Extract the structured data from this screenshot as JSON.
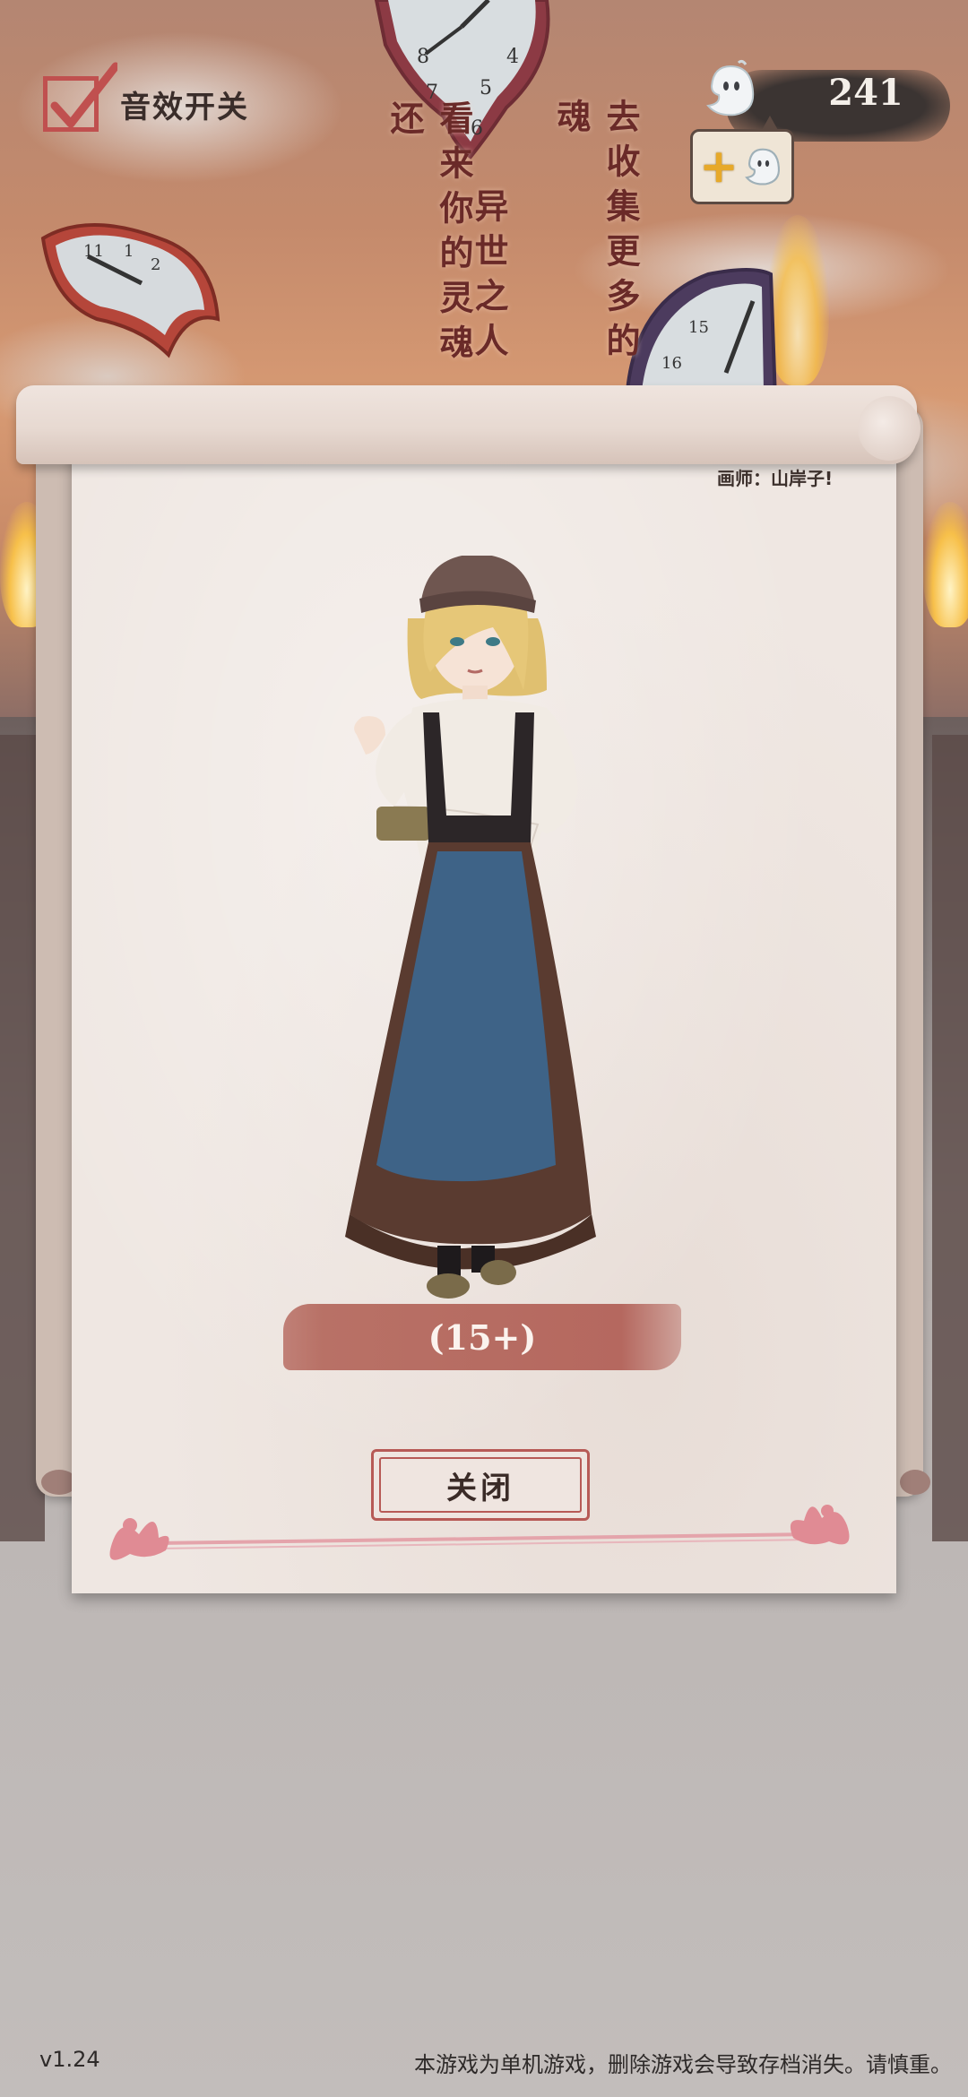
{
  "header": {
    "sound_toggle_label": "音效开关",
    "sound_enabled": true,
    "soul_currency": "241"
  },
  "story": {
    "line_right": "去收集更多的魂",
    "line_middle": "异世之人",
    "line_left": "看来你的灵魂还"
  },
  "card": {
    "artist_credit": "画师：山岸子!",
    "age_label": "(15+)",
    "close_label": "关闭"
  },
  "footer": {
    "version": "v1.24",
    "notice": "本游戏为单机游戏，删除游戏会导致存档消失。请慎重。"
  },
  "colors": {
    "accent_red": "#b75a56",
    "banner": "#b5685f",
    "paper": "#efe7e2",
    "text_dark": "#3a2b27"
  },
  "icons": [
    "checkmark-icon",
    "soul-ghost-icon",
    "plus-icon",
    "clock-icon",
    "flourish-ornament"
  ]
}
